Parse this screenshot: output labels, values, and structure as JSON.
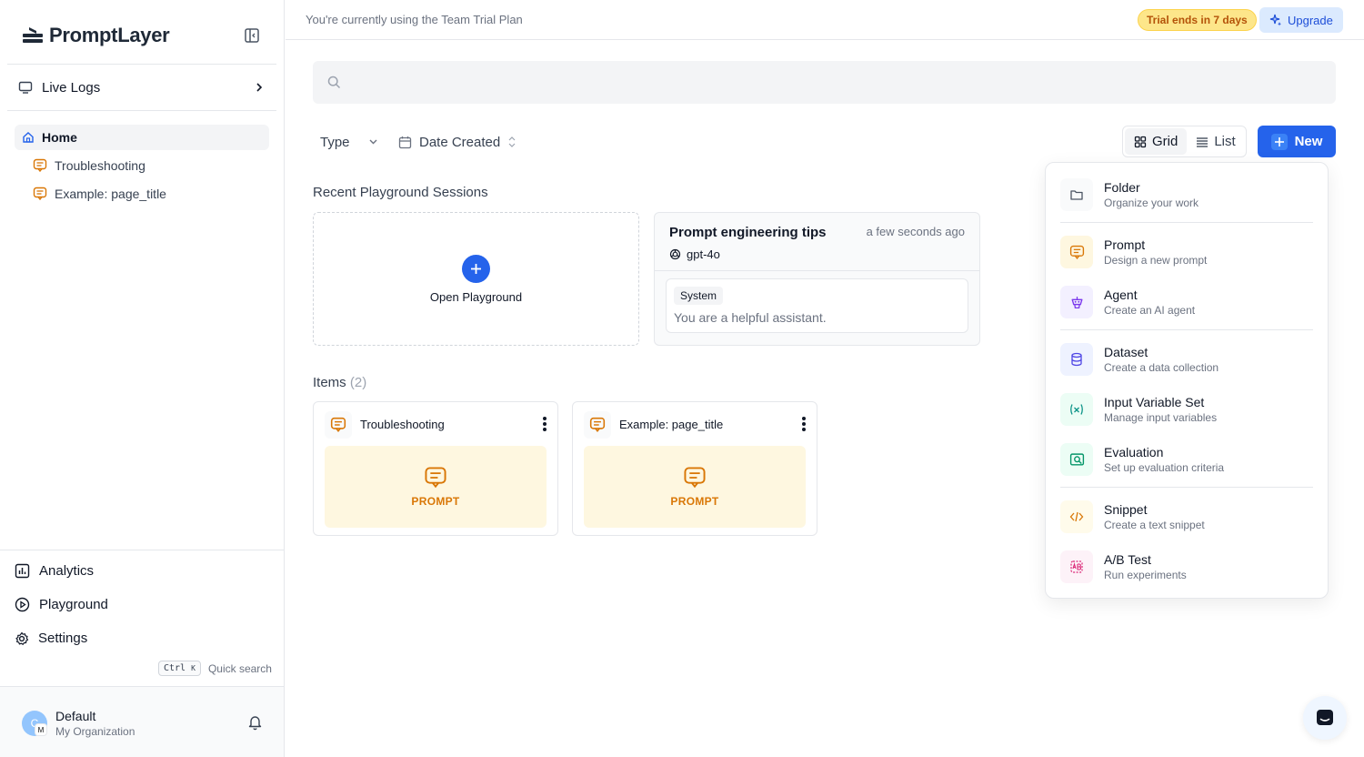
{
  "app": {
    "name": "PromptLayer"
  },
  "sidebar": {
    "live_logs": "Live Logs",
    "home": "Home",
    "items": [
      "Troubleshooting",
      "Example: page_title"
    ],
    "analytics": "Analytics",
    "playground": "Playground",
    "settings": "Settings",
    "kbd_ctrl": "Ctrl",
    "kbd_k": "K",
    "quick_search": "Quick search",
    "user": {
      "initial": "C",
      "badge": "M",
      "name": "Default",
      "org": "My Organization"
    }
  },
  "topbar": {
    "plan_text": "You're currently using the Team Trial Plan",
    "trial_badge": "Trial ends in 7 days",
    "upgrade": "Upgrade",
    "trial_color": "#b45309"
  },
  "search": {
    "placeholder": ""
  },
  "filters": {
    "type": "Type",
    "date": "Date Created"
  },
  "view": {
    "grid": "Grid",
    "list": "List",
    "active": "grid"
  },
  "new_button": "New",
  "recent": {
    "title": "Recent Playground Sessions",
    "open_playground": "Open Playground",
    "session": {
      "title": "Prompt engineering tips",
      "time": "a few seconds ago",
      "model": "gpt-4o",
      "role": "System",
      "content": "You are a helpful assistant."
    }
  },
  "items_section": {
    "title": "Items",
    "count": "(2)",
    "cards": [
      {
        "name": "Troubleshooting",
        "type": "PROMPT"
      },
      {
        "name": "Example: page_title",
        "type": "PROMPT"
      }
    ]
  },
  "new_menu": [
    {
      "title": "Folder",
      "desc": "Organize your work",
      "icon": "folder-icon"
    },
    {
      "title": "Prompt",
      "desc": "Design a new prompt",
      "icon": "prompt-icon"
    },
    {
      "title": "Agent",
      "desc": "Create an AI agent",
      "icon": "agent-icon"
    },
    {
      "title": "Dataset",
      "desc": "Create a data collection",
      "icon": "dataset-icon"
    },
    {
      "title": "Input Variable Set",
      "desc": "Manage input variables",
      "icon": "variable-icon"
    },
    {
      "title": "Evaluation",
      "desc": "Set up evaluation criteria",
      "icon": "evaluation-icon"
    },
    {
      "title": "Snippet",
      "desc": "Create a text snippet",
      "icon": "code-icon"
    },
    {
      "title": "A/B Test",
      "desc": "Run experiments",
      "icon": "ab-test-icon"
    }
  ],
  "colors": {
    "accent": "#2563eb",
    "prompt": "#d97706"
  }
}
